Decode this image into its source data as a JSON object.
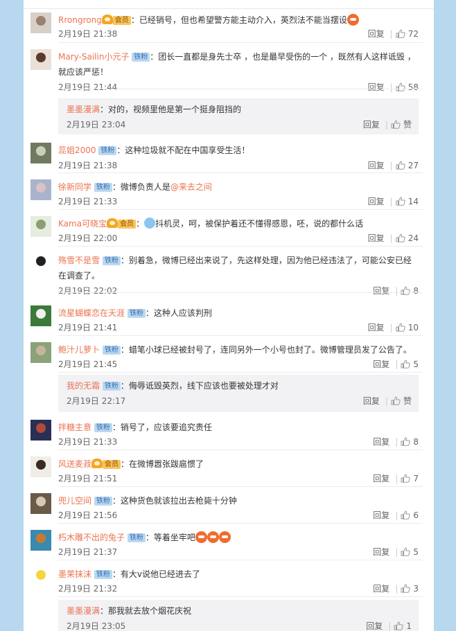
{
  "comments": [
    {
      "user": "Rrongrong",
      "badge": "crown",
      "text": "：已经销号，但也希望警方能主动介入，英烈法不能当摆设",
      "emoji_after": 1,
      "time": "2月19日 21:38",
      "reply": "回复",
      "likes": "72",
      "avatar_colors": [
        "#d8d0c8",
        "#9a8070"
      ]
    },
    {
      "user": "Mary-Sailin小元子",
      "badge": "铁粉",
      "text": "：团长一直都是身先士卒 ，也是最早受伤的一个 ，既然有人这样诋毁 ，就应该严惩！",
      "time": "2月19日 21:44",
      "reply": "回复",
      "likes": "58",
      "avatar_colors": [
        "#eae0d8",
        "#5a3a2a"
      ]
    },
    {
      "user": "蕊姐2000",
      "badge": "铁粉",
      "text": "：这种垃圾就不配在中国享受生活！",
      "time": "2月19日 21:38",
      "reply": "回复",
      "likes": "27",
      "avatar_colors": [
        "#6f7a60",
        "#c8d0b8"
      ]
    },
    {
      "user": "徐新同学",
      "badge": "铁粉",
      "text": "：微博负责人是",
      "mention": "@来去之间",
      "time": "2月19日 21:33",
      "reply": "回复",
      "likes": "14",
      "avatar_colors": [
        "#a9b4cc",
        "#d9c2c8"
      ]
    },
    {
      "user": "Kama可晓宝",
      "badge": "crown",
      "text": "抖机灵，呵，被保护着还不懂得感恩，呸，说的都什么话",
      "emoji_before": "blue",
      "time": "2月19日 22:00",
      "reply": "回复",
      "likes": "24",
      "avatar_colors": [
        "#e6ece0",
        "#89a070"
      ]
    },
    {
      "user": "殇雪不是雪",
      "badge": "铁粉",
      "text": "：别着急，微博已经出来说了，先这样处理，因为他已经违法了，可能公安已经在调查了。",
      "time": "2月19日 22:02",
      "reply": "回复",
      "likes": "8",
      "avatar_colors": [
        "#ffffff",
        "#222222"
      ]
    },
    {
      "user": "流星蝴蝶恋在天涯",
      "badge": "铁粉",
      "text": "：这种人应该判刑",
      "time": "2月19日 21:41",
      "reply": "回复",
      "likes": "10",
      "avatar_colors": [
        "#3d7a3a",
        "#f0f0f0"
      ]
    },
    {
      "user": "鲍汁儿萝卜",
      "badge": "铁粉",
      "text": "：蜡笔小球已经被封号了，连同另外一个小号也封了。微博管理员发了公告了。",
      "time": "2月19日 21:45",
      "reply": "回复",
      "likes": "5",
      "avatar_colors": [
        "#8aa37a",
        "#c9b3a0"
      ]
    },
    {
      "user": "拌糖主意",
      "badge": "铁粉",
      "text": "：销号了，应该要追究责任",
      "time": "2月19日 21:33",
      "reply": "回复",
      "likes": "8",
      "avatar_colors": [
        "#2a2f55",
        "#b24a3a"
      ]
    },
    {
      "user": "风送麦菽",
      "badge": "crown",
      "text": "：在微博嚣张跋扈惯了",
      "time": "2月19日 21:51",
      "reply": "回复",
      "likes": "7",
      "avatar_colors": [
        "#f0ece8",
        "#3a2a22"
      ]
    },
    {
      "user": "兜儿空间",
      "badge": "铁粉",
      "text": "：这种货色就该拉出去枪毙十分钟",
      "time": "2月19日 21:56",
      "reply": "回复",
      "likes": "6",
      "avatar_colors": [
        "#6a5a48",
        "#d8c8b0"
      ]
    },
    {
      "user": "朽木雕不出的兔子",
      "badge": "铁粉",
      "text": "：等着坐牢吧",
      "emoji_after": 3,
      "time": "2月19日 21:37",
      "reply": "回复",
      "likes": "5",
      "avatar_colors": [
        "#3a8ab0",
        "#c87a30"
      ]
    },
    {
      "user": "墨茉抹沫",
      "badge": "铁粉",
      "text": "：有大v说他已经进去了",
      "time": "2月19日 21:32",
      "reply": "回复",
      "likes": "3",
      "avatar_colors": [
        "#ffffff",
        "#f5d442"
      ]
    }
  ],
  "subs": [
    {
      "user": "墨墨漫满",
      "badge": "",
      "text": "：对的，视频里他是第一个挺身阻挡的",
      "time": "2月19日 23:04",
      "reply": "回复",
      "likes": "赞"
    },
    {
      "user": "我的无霜",
      "badge": "铁粉",
      "text": "：侮辱诋毁英烈，线下应该也要被处理才对",
      "time": "2月19日 22:17",
      "reply": "回复",
      "likes": "赞"
    },
    {
      "user": "墨墨漫满",
      "badge": "",
      "text": "：那我就去放个烟花庆祝",
      "time": "2月19日 23:05",
      "reply": "回复",
      "likes": "1"
    }
  ],
  "crown_label": "会员",
  "colors": {
    "username": "#eb7350",
    "link": "#eb7350",
    "tag_bg": "#bcd8f0",
    "page_bg": "#b7d8ee"
  }
}
